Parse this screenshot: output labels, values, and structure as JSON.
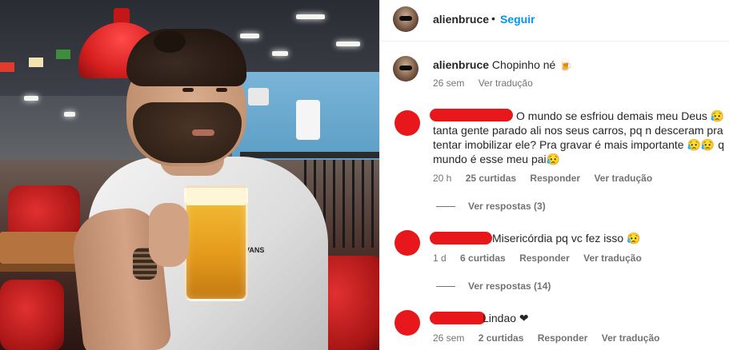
{
  "post": {
    "username": "alienbruce",
    "separator": "•",
    "follow_label": "Seguir",
    "shirt_brand": "VANS"
  },
  "caption": {
    "username": "alienbruce",
    "text": "Chopinho né 🍺",
    "time": "26 sem",
    "see_translation": "Ver tradução"
  },
  "comments": [
    {
      "text_line1": "O mundo se esfriou demais meu Deus 😥",
      "text_line2": "tanta gente parado ali nos seus carros, pq n desceram pra",
      "text_line3": "tentar imobilizar ele? Pra gravar é mais importante 😥😥 q",
      "text_line4": "mundo é esse meu pai😥",
      "time": "20 h",
      "likes": "25 curtidas",
      "reply": "Responder",
      "see_translation": "Ver tradução",
      "view_replies": "Ver respostas (3)"
    },
    {
      "text_line1": "Misericórdia pq vc fez isso 😥",
      "time": "1 d",
      "likes": "6 curtidas",
      "reply": "Responder",
      "see_translation": "Ver tradução",
      "view_replies": "Ver respostas (14)"
    },
    {
      "text_line1": "Lindao ❤",
      "time": "26 sem",
      "likes": "2 curtidas",
      "reply": "Responder",
      "see_translation": "Ver tradução"
    }
  ],
  "colors": {
    "accent": "#0095f6",
    "redaction": "#e8171b",
    "muted": "#737373"
  }
}
